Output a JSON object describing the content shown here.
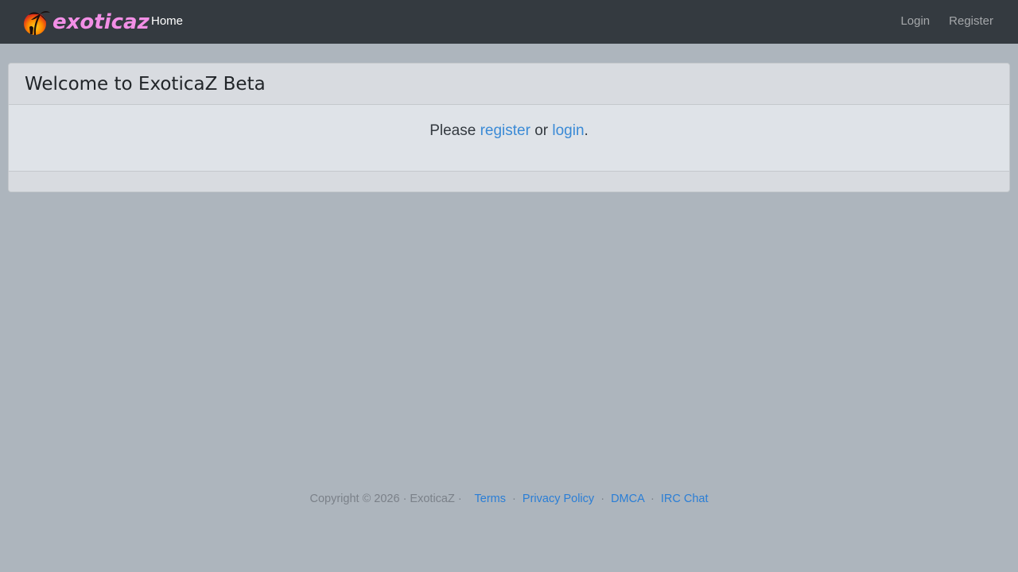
{
  "navbar": {
    "brand_text": "exoticaz",
    "home_label": "Home",
    "login_label": "Login",
    "register_label": "Register"
  },
  "card": {
    "title": "Welcome to ExoticaZ Beta",
    "text_before": "Please ",
    "register_link": "register",
    "text_middle": " or ",
    "login_link": "login",
    "text_after": "."
  },
  "footer": {
    "copyright": "Copyright © 2026 · ExoticaZ ·",
    "links": [
      "Terms",
      "Privacy Policy",
      "DMCA",
      "IRC Chat"
    ],
    "separator": "·"
  },
  "colors": {
    "navbar_bg": "#343a40",
    "page_bg": "#adb5bd",
    "brand": "#f28fe6",
    "link": "#3a8ad6"
  },
  "icons": {
    "brand_logo": "sunset-palm-logo-icon"
  }
}
